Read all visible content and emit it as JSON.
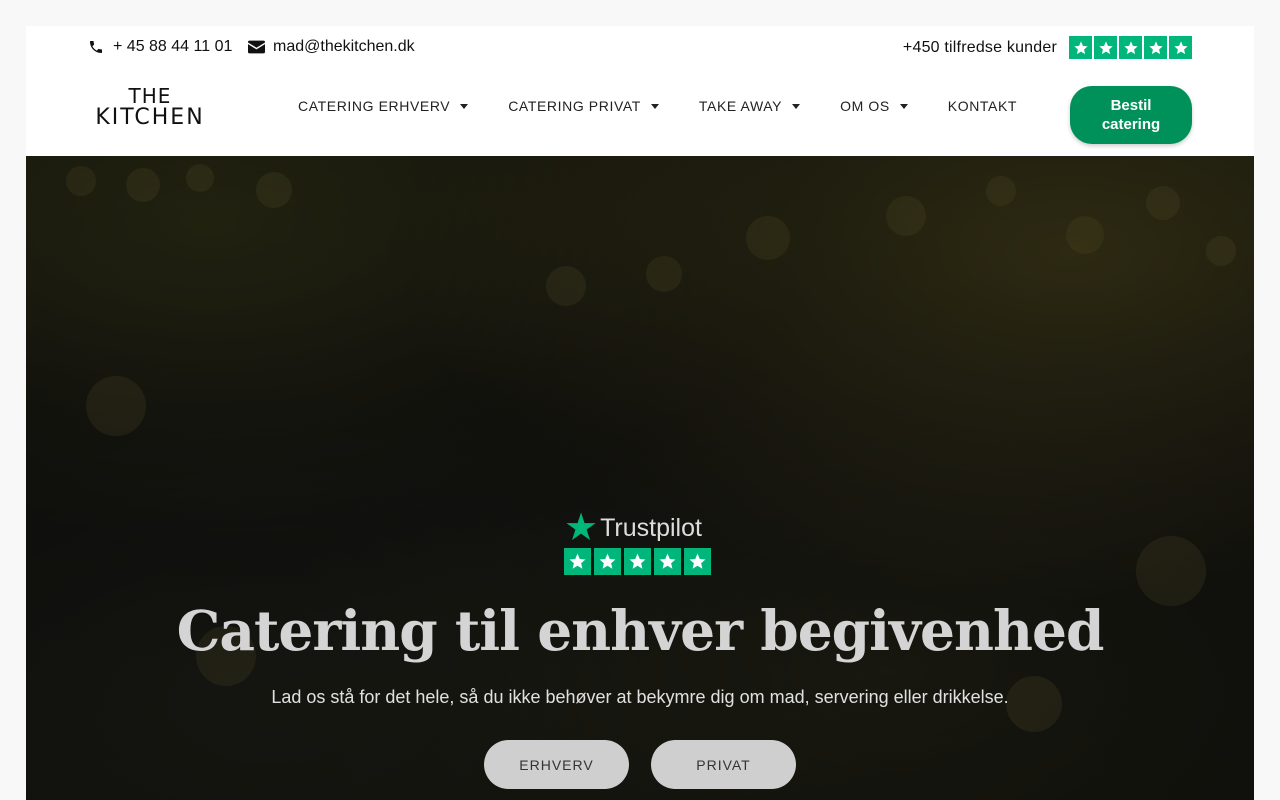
{
  "topbar": {
    "phone": "+ 45 88 44 11 01",
    "email": "mad@thekitchen.dk",
    "trust_text": "+450 tilfredse kunder",
    "trust_rating": 5
  },
  "logo": {
    "line1": "THE",
    "line2": "KITCHEN"
  },
  "nav": {
    "items": [
      {
        "label": "CATERING ERHVERV",
        "dropdown": true
      },
      {
        "label": "CATERING PRIVAT",
        "dropdown": true
      },
      {
        "label": "TAKE AWAY",
        "dropdown": true
      },
      {
        "label": "OM OS",
        "dropdown": true
      },
      {
        "label": "KONTAKT",
        "dropdown": false
      }
    ],
    "cta_label": "Bestil catering"
  },
  "hero": {
    "trustpilot_brand": "Trustpilot",
    "trustpilot_rating": 5,
    "headline": "Catering til enhver begivenhed",
    "subline": "Lad os stå for det hele, så du ikke behøver at bekymre dig om mad, servering eller drikkelse.",
    "buttons": {
      "erhverv": "ERHVERV",
      "privat": "PRIVAT"
    }
  },
  "colors": {
    "trustpilot_green": "#00b67a",
    "cta_green": "#00915a",
    "hero_button": "#cfcfcf"
  },
  "icons": {
    "phone": "phone-icon",
    "email": "envelope-icon",
    "star": "star-icon",
    "caret": "chevron-down-icon"
  }
}
